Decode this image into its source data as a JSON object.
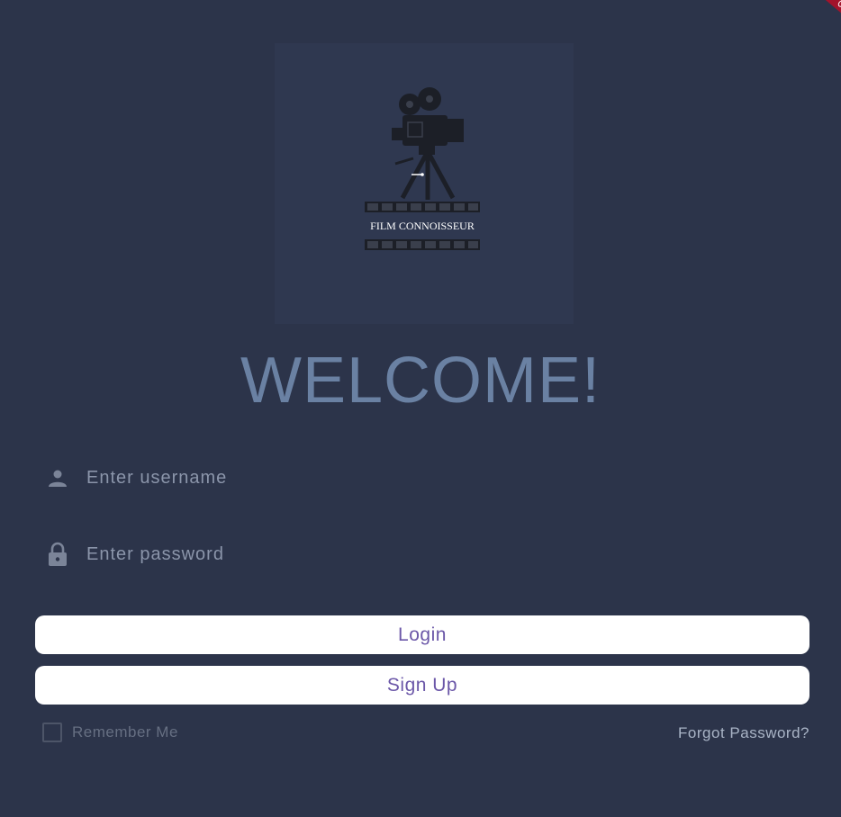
{
  "logo": {
    "brand_text": "FILM CONNOISSEUR",
    "icon": "film-camera-logo"
  },
  "heading": "WELCOME!",
  "username": {
    "placeholder": "Enter username",
    "value": "",
    "icon": "person-icon"
  },
  "password": {
    "placeholder": "Enter password",
    "value": "",
    "icon": "lock-icon"
  },
  "buttons": {
    "login": "Login",
    "signup": "Sign Up"
  },
  "remember_me": {
    "label": "Remember Me",
    "checked": false
  },
  "forgot_password": "Forgot Password?",
  "colors": {
    "background": "#2c344a",
    "heading": "#6a81a3",
    "button_text": "#6b57a8",
    "button_bg": "#ffffff",
    "debug_ribbon": "#a3132b"
  }
}
